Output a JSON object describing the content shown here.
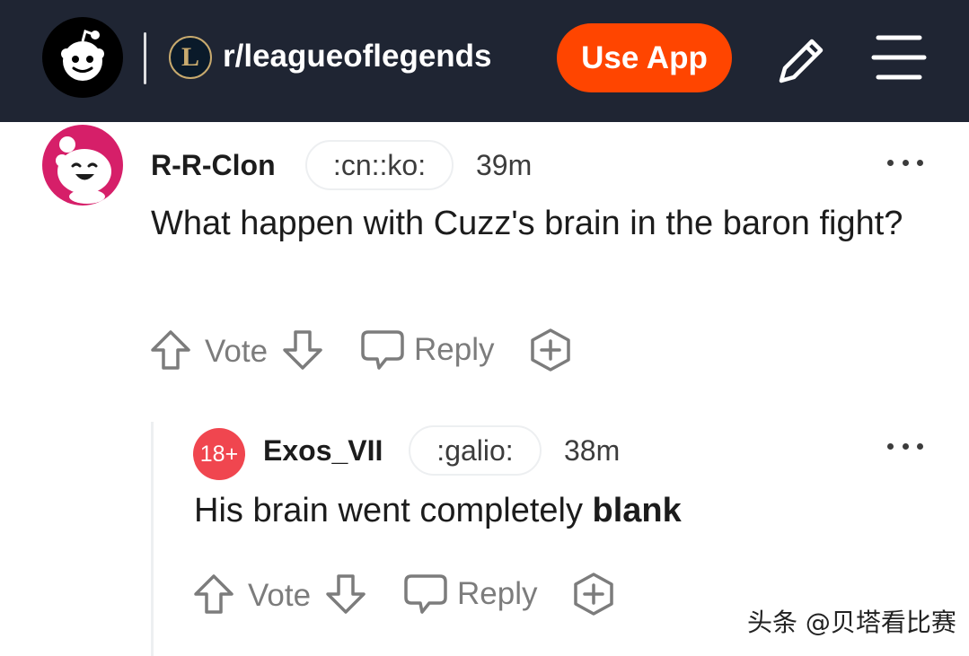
{
  "header": {
    "logo_icon": "reddit-snoo-icon",
    "subreddit_icon": "league-of-legends-icon",
    "subreddit_icon_letter": "L",
    "subreddit_name": "r/leagueoflegends",
    "use_app_label": "Use App",
    "pencil_icon": "pencil-icon",
    "menu_icon": "hamburger-menu-icon",
    "colors": {
      "bar": "#1f2533",
      "accent": "#ff4500"
    }
  },
  "comments": [
    {
      "username": "R-R-Clon",
      "flair": ":cn::ko:",
      "time": "39m",
      "text": "What happen with Cuzz's brain in the baron fight?",
      "vote_label": "Vote",
      "reply_label": "Reply"
    },
    {
      "badge": "18+",
      "username": "Exos_VII",
      "flair": ":galio:",
      "time": "38m",
      "text_plain": "His brain went completely ",
      "text_bold": "blank",
      "vote_label": "Vote",
      "reply_label": "Reply"
    }
  ],
  "watermark": "头条 @贝塔看比赛"
}
